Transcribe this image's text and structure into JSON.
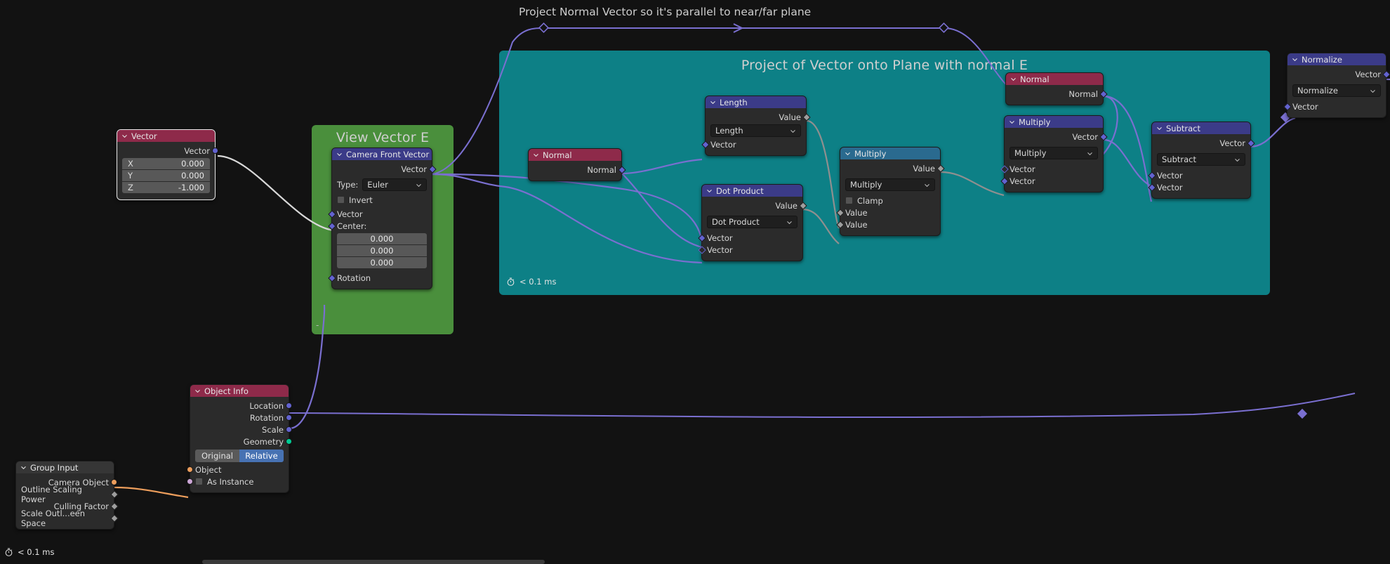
{
  "app": {
    "editor": "blender-geometry-node-editor"
  },
  "annotations": {
    "top_comment": "Project Normal Vector so it's parallel to near/far plane"
  },
  "frames": [
    {
      "label": "View Vector E",
      "color": "#4a8f3c"
    },
    {
      "label": "Project of Vector onto Plane with normal E",
      "color": "#0d8086",
      "timer": "< 0.1 ms"
    }
  ],
  "status": {
    "timer": "< 0.1 ms"
  },
  "nodes": {
    "vector_input": {
      "title": "Vector",
      "outputs": [
        {
          "label": "Vector",
          "type": "vector"
        }
      ],
      "fields": [
        {
          "key": "X",
          "value": "0.000"
        },
        {
          "key": "Y",
          "value": "0.000"
        },
        {
          "key": "Z",
          "value": "-1.000"
        }
      ]
    },
    "camera_front_vector": {
      "title": "Camera Front Vector",
      "outputs": [
        {
          "label": "Vector",
          "type": "vector"
        }
      ],
      "type_label": "Type:",
      "type_value": "Euler",
      "invert_label": "Invert",
      "inputs": [
        {
          "label": "Vector",
          "type": "vector"
        },
        {
          "label": "Center:",
          "type": "vector"
        }
      ],
      "center_values": [
        "0.000",
        "0.000",
        "0.000"
      ],
      "rotation_label": "Rotation"
    },
    "object_info": {
      "title": "Object Info",
      "outputs": [
        {
          "label": "Location",
          "type": "vector"
        },
        {
          "label": "Rotation",
          "type": "vector"
        },
        {
          "label": "Scale",
          "type": "vector"
        },
        {
          "label": "Geometry",
          "type": "geometry"
        }
      ],
      "toggles": [
        {
          "label": "Original",
          "active": false
        },
        {
          "label": "Relative",
          "active": true
        }
      ],
      "object_label": "Object",
      "as_instance_label": "As Instance"
    },
    "group_input": {
      "title": "Group Input",
      "outputs": [
        {
          "label": "Camera Object",
          "type": "object"
        },
        {
          "label": "Outline Scaling Power",
          "type": "value"
        },
        {
          "label": "Culling Factor",
          "type": "value"
        },
        {
          "label": "Scale Outl...een Space",
          "type": "value"
        }
      ]
    },
    "normal_a": {
      "title": "Normal",
      "outputs": [
        {
          "label": "Normal",
          "type": "vector"
        }
      ]
    },
    "length": {
      "title": "Length",
      "outputs": [
        {
          "label": "Value",
          "type": "value"
        }
      ],
      "operation": "Length",
      "inputs": [
        {
          "label": "Vector",
          "type": "vector"
        }
      ]
    },
    "dot_product": {
      "title": "Dot Product",
      "outputs": [
        {
          "label": "Value",
          "type": "value"
        }
      ],
      "operation": "Dot Product",
      "inputs": [
        {
          "label": "Vector",
          "type": "vector"
        },
        {
          "label": "Vector",
          "type": "vector"
        }
      ]
    },
    "multiply_math": {
      "title": "Multiply",
      "outputs": [
        {
          "label": "Value",
          "type": "value"
        }
      ],
      "operation": "Multiply",
      "clamp_label": "Clamp",
      "inputs": [
        {
          "label": "Value",
          "type": "value"
        },
        {
          "label": "Value",
          "type": "value"
        }
      ]
    },
    "normal_b": {
      "title": "Normal",
      "outputs": [
        {
          "label": "Normal",
          "type": "vector"
        }
      ]
    },
    "multiply_vector": {
      "title": "Multiply",
      "outputs": [
        {
          "label": "Vector",
          "type": "vector"
        }
      ],
      "operation": "Multiply",
      "inputs": [
        {
          "label": "Vector",
          "type": "vector"
        },
        {
          "label": "Vector",
          "type": "vector"
        }
      ]
    },
    "subtract": {
      "title": "Subtract",
      "outputs": [
        {
          "label": "Vector",
          "type": "vector"
        }
      ],
      "operation": "Subtract",
      "inputs": [
        {
          "label": "Vector",
          "type": "vector"
        },
        {
          "label": "Vector",
          "type": "vector"
        }
      ]
    },
    "normalize": {
      "title": "Normalize",
      "outputs": [
        {
          "label": "Vector",
          "type": "vector"
        }
      ],
      "operation": "Normalize",
      "inputs": [
        {
          "label": "Vector",
          "type": "vector"
        }
      ]
    }
  },
  "colors": {
    "header_red": "#8e2a4a",
    "header_purple": "#3b3b88",
    "header_blue": "#2a6a8f",
    "socket_vector": "#6363d0",
    "socket_value": "#9e9e9e",
    "socket_geometry": "#00cc95",
    "socket_object": "#ed9e5c",
    "frame_green": "#4a8f3c",
    "frame_teal": "#0d8086",
    "wire_vector": "#7a6fd0",
    "wire_object": "#ed9e5c",
    "wire_white": "#d8d8d8"
  }
}
